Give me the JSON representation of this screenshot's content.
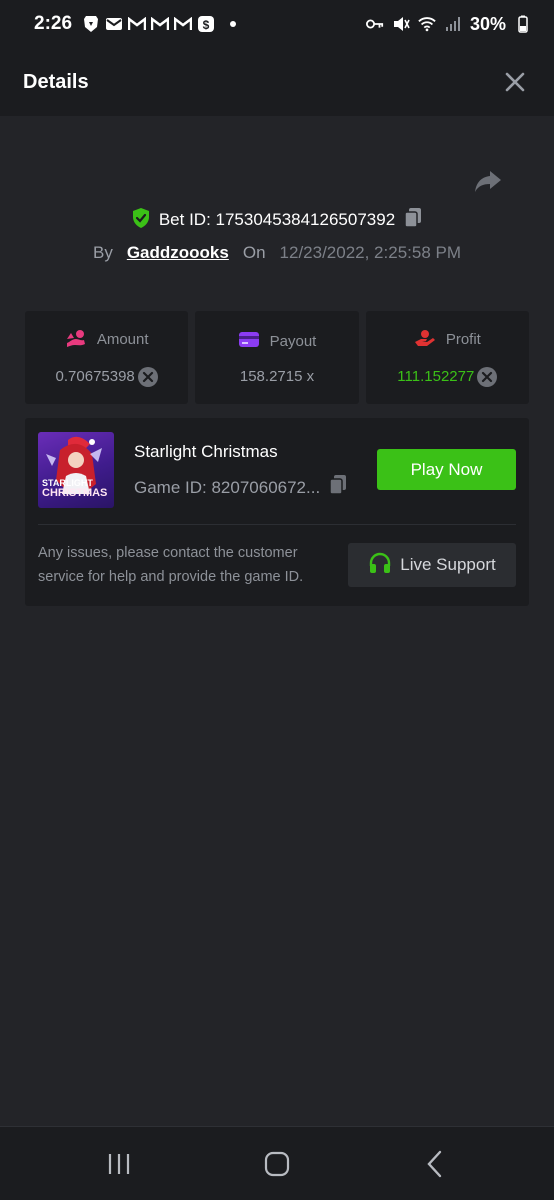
{
  "status_bar": {
    "time": "2:26",
    "battery": "30%"
  },
  "header": {
    "title": "Details"
  },
  "bet": {
    "bet_id_label": "Bet ID: 1753045384126507392",
    "by_label": "By",
    "username": "Gaddzoooks",
    "on_label": "On",
    "datetime": "12/23/2022, 2:25:58 PM"
  },
  "stats": {
    "amount_label": "Amount",
    "amount_value": "0.70675398",
    "payout_label": "Payout",
    "payout_value": "158.2715 x",
    "profit_label": "Profit",
    "profit_value": "111.152277"
  },
  "game": {
    "thumb_line1": "STARLIGHT",
    "thumb_line2": "CHRISTMAS",
    "title": "Starlight Christmas",
    "game_id": "Game ID: 8207060672...",
    "play_label": "Play Now",
    "support_text": "Any issues, please contact the customer service for help and provide the game ID.",
    "support_label": "Live Support"
  },
  "colors": {
    "accent_green": "#3bc117",
    "background": "#232428",
    "card": "#1b1c1f",
    "amount_icon": "#e83a7e",
    "payout_icon": "#8b3cf2",
    "profit_icon": "#e03232"
  },
  "icons": {
    "shield": "shield-check-icon",
    "copy": "copy-icon",
    "share": "share-icon",
    "close": "close-icon",
    "coin": "coin-icon",
    "headset": "headset-icon"
  }
}
